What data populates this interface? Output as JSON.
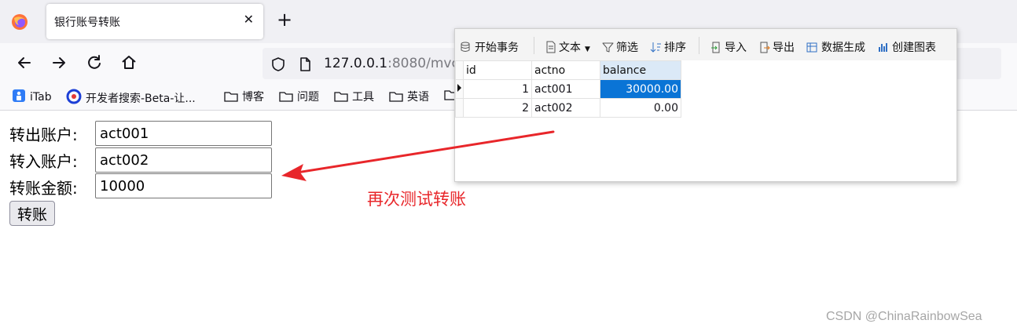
{
  "browser": {
    "tab_title": "银行账号转账",
    "tab_close": "✕",
    "new_tab": "+",
    "url_host": "127.0.0.1",
    "url_rest": ":8080/mvc/"
  },
  "bookmarks": [
    {
      "label": "iTab",
      "icon": "itab-icon"
    },
    {
      "label": "开发者搜索-Beta-让...",
      "icon": "search-logo-icon"
    },
    {
      "label": "博客",
      "icon": "folder-icon"
    },
    {
      "label": "问题",
      "icon": "folder-icon"
    },
    {
      "label": "工具",
      "icon": "folder-icon"
    },
    {
      "label": "英语",
      "icon": "folder-icon"
    }
  ],
  "form": {
    "from_label": "转出账户:",
    "from_value": "act001",
    "to_label": "转入账户:",
    "to_value": "act002",
    "amount_label": "转账金额:",
    "amount_value": "10000",
    "submit_label": "转账"
  },
  "db": {
    "toolbar": {
      "begin_tx": "开始事务",
      "text": "文本",
      "filter": "筛选",
      "sort": "排序",
      "import": "导入",
      "export": "导出",
      "datagen": "数据生成",
      "chart": "创建图表"
    },
    "columns": [
      "id",
      "actno",
      "balance"
    ],
    "rows": [
      {
        "id": "1",
        "actno": "act001",
        "balance": "30000.00"
      },
      {
        "id": "2",
        "actno": "act002",
        "balance": "0.00"
      }
    ],
    "selected_color": "#0a74d6"
  },
  "annotation": {
    "text": "再次测试转账",
    "color": "#e8262a"
  },
  "watermark": "CSDN @ChinaRainbowSea"
}
